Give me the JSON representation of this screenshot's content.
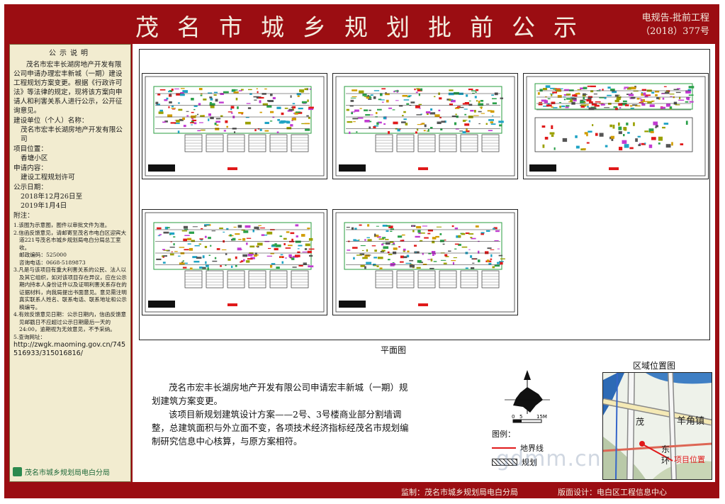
{
  "header": {
    "title": "茂名市城乡规划批前公示",
    "doc_number_line1": "电规告-批前工程",
    "doc_number_line2": "（2018）377号"
  },
  "sidebar": {
    "heading": "公示说明",
    "body": "茂名市宏丰长湖房地产开发有限公司申请办理宏丰新城（一期）建设工程规划方案变更。根据《行政许可法》等法律的规定，现将该方案向申请人和利害关系人进行公示，公开征询意见。",
    "unit_label": "建设单位（个人）名称：",
    "unit_value": "茂名市宏丰长湖房地产开发有限公司",
    "location_label": "项目位置：",
    "location_value": "香塘小区",
    "apply_label": "申请内容：",
    "apply_value": "建设工程规划许可",
    "date_label": "公示日期：",
    "date_from": "2018年12月26日至",
    "date_to": "2019年1月4日",
    "notes_label": "附注：",
    "notes": [
      "1.该图为示意图，图件以审批文件为准。",
      "2.信函反馈意见，请邮寄至茂名市电白区迎宾大道221号茂名市城乡规划局电白分局总工室收。",
      "邮政编码：525000",
      "咨询电话：0668-5189873",
      "3.凡是与该项目有重大利害关系的公民、法人以及其它组织，如对该项目存在异议，应在公示期内持本人身份证件以及证明利害关系存在的证据材料，向我局提出书面意见。意见需注明真实联系人姓名、联系电话、联系地址和公示稿编号。",
      "4.有效反馈意见日期：公示日期内，信函反馈意见邮戳日不应超过公示日期最后一天的24:00，逾期视为无效意见，不予采纳。",
      "5.查询网址："
    ],
    "url": "http://zwgk.maoming.gov.cn/745516933/315016816/",
    "footer_org": "茂名市城乡规划局电白分局"
  },
  "main": {
    "plan_caption": "平面图",
    "description_1": "茂名市宏丰长湖房地产开发有限公司申请宏丰新城（一期）规划建筑方案变更。",
    "description_2": "该项目新规划建筑设计方案——2号、3号楼商业部分割墙调整，总建筑面积与外立面不变，各项技术经济指标经茂名市规划编制研究信息中心核算，与原方案相符。",
    "scale_labels": [
      "0",
      "5",
      "15M"
    ],
    "legend_title": "图例：",
    "legend_items": [
      {
        "label": "地界线",
        "color": "#e0191a"
      },
      {
        "label": "规划",
        "color": "#333333"
      }
    ],
    "location_title": "区域位置图",
    "map_labels": [
      "羊角镇",
      "茂",
      "东",
      "环",
      "项目位置"
    ]
  },
  "footer": {
    "supervisor": "监制：茂名市城乡规划局电白分局",
    "designer": "版面设计：电白区工程信息中心"
  },
  "watermark": "gdmm.cn"
}
